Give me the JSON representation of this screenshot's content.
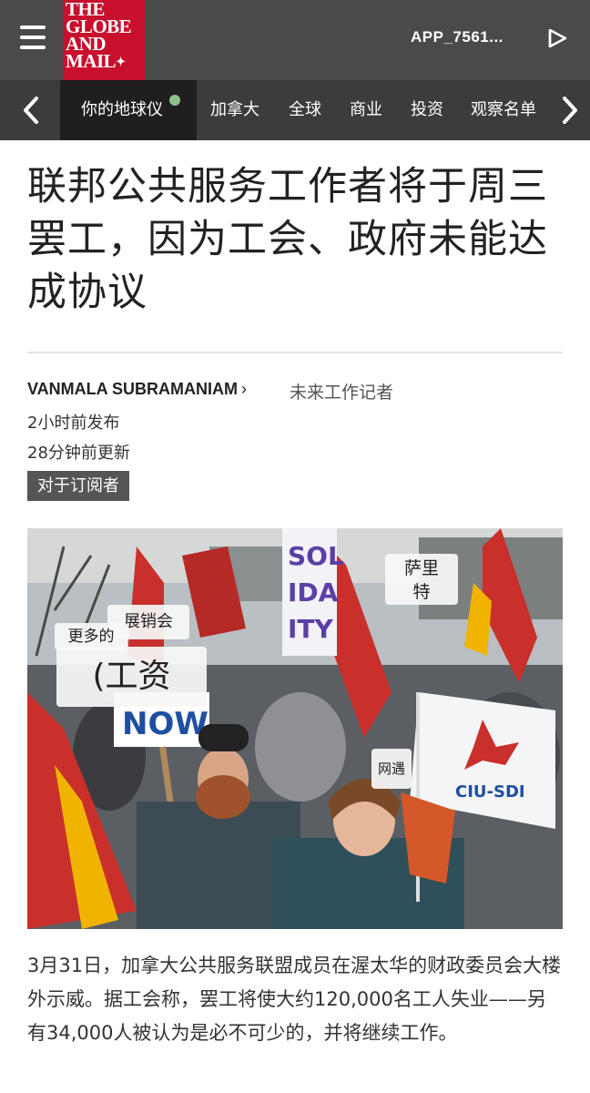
{
  "header": {
    "logo_lines": [
      "THE",
      "GLOBE",
      "AND",
      "MAIL"
    ],
    "app_id": "APP_7561...",
    "menu_icon": "hamburger-menu-icon",
    "play_icon": "play-icon"
  },
  "nav": {
    "items": [
      {
        "label": "你的地球仪",
        "active": true
      },
      {
        "label": "加拿大"
      },
      {
        "label": "全球"
      },
      {
        "label": "商业"
      },
      {
        "label": "投资"
      },
      {
        "label": "观察名单"
      }
    ]
  },
  "article": {
    "headline": "联邦公共服务工作者将于周三罢工，因为工会、政府未能达成协议",
    "author": "VANMALA SUBRAMANIAM",
    "author_chevron": "›",
    "role": "未来工作记者",
    "published": "2小时前发布",
    "updated": "28分钟前更新",
    "badge": "对于订阅者",
    "photo": {
      "overlays": {
        "fair": "展销会",
        "more": "更多的",
        "wages": "(工资",
        "sarit": "萨里\n特",
        "side": "网遇",
        "now": "NOW",
        "ciu": "CIU-SDI"
      },
      "colors": {
        "flag_red": "#c9302c",
        "flag_yellow": "#f0b400",
        "coat_teal": "#2f4f5a"
      }
    },
    "caption": "3月31日，加拿大公共服务联盟成员在渥太华的财政委员会大楼外示威。据工会称，罢工将使大约120,000名工人失业——另有34,000人被认为是必不可少的，并将继续工作。"
  }
}
